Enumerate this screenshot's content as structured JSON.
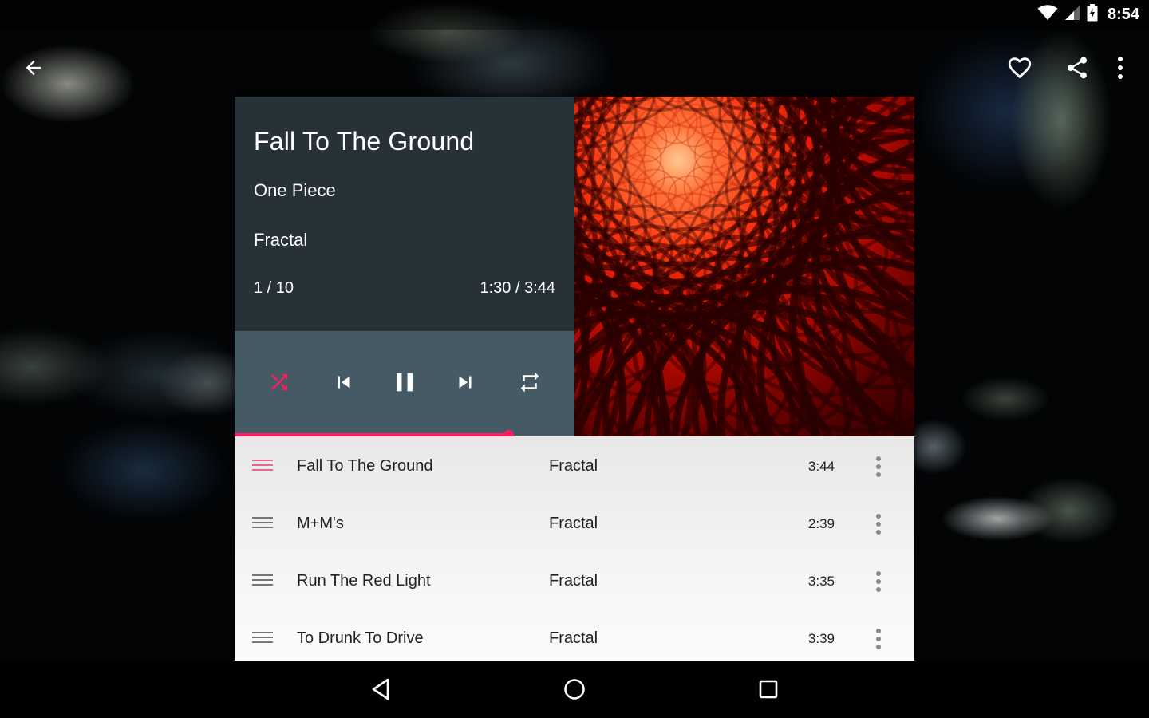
{
  "status_bar": {
    "time": "8:54",
    "icons": [
      "wifi-icon",
      "cell-signal-icon",
      "battery-charging-icon"
    ]
  },
  "toolbar": {
    "back_icon": "arrow-back-icon",
    "actions": [
      {
        "name": "favorite",
        "icon": "heart-outline-icon"
      },
      {
        "name": "share",
        "icon": "share-icon"
      },
      {
        "name": "more",
        "icon": "more-vert-icon"
      }
    ]
  },
  "now_playing": {
    "title": "Fall To The Ground",
    "album": "One Piece",
    "artist": "Fractal",
    "track_position": "1 / 10",
    "time": "1:30 / 3:44",
    "progress_fraction": 0.402,
    "accent_color": "#ff1b5e"
  },
  "controls": [
    {
      "name": "shuffle",
      "icon": "shuffle-icon",
      "active": true
    },
    {
      "name": "previous",
      "icon": "skip-previous-icon",
      "active": false
    },
    {
      "name": "pause",
      "icon": "pause-icon",
      "active": false
    },
    {
      "name": "next",
      "icon": "skip-next-icon",
      "active": false
    },
    {
      "name": "repeat",
      "icon": "repeat-icon",
      "active": false
    }
  ],
  "playlist": [
    {
      "title": "Fall To The Ground",
      "artist": "Fractal",
      "duration": "3:44",
      "active": true
    },
    {
      "title": "M+M's",
      "artist": "Fractal",
      "duration": "2:39",
      "active": false
    },
    {
      "title": "Run The Red Light",
      "artist": "Fractal",
      "duration": "3:35",
      "active": false
    },
    {
      "title": "To Drunk To Drive",
      "artist": "Fractal",
      "duration": "3:39",
      "active": false
    }
  ],
  "nav_bar": {
    "buttons": [
      "back-triangle-icon",
      "home-circle-icon",
      "recents-square-icon"
    ]
  }
}
